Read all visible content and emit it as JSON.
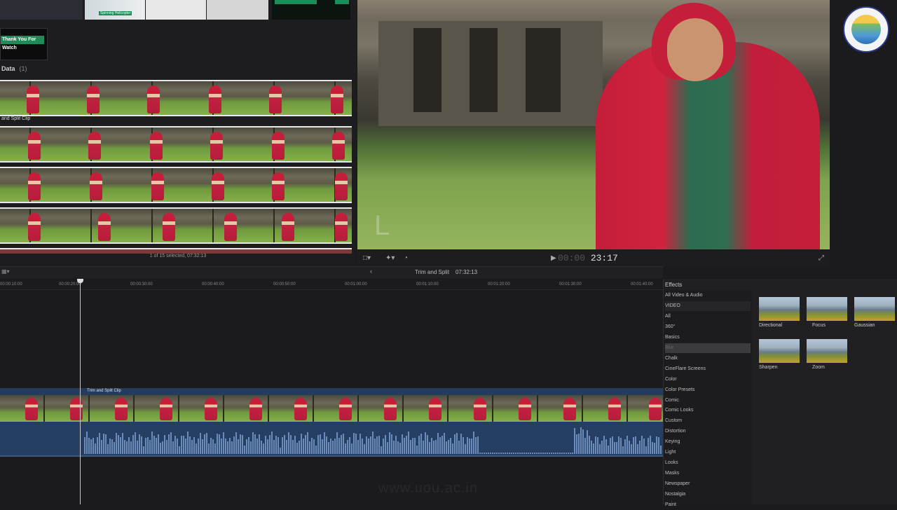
{
  "browser": {
    "thanks_label": "Thank You For Watch",
    "thumb_caption": "Spinning Helicopter",
    "event_name": "Data",
    "event_count": "(1)",
    "clip_name": "and Split Clip",
    "status": "1 of 15 selected, 07:32:13"
  },
  "viewer": {
    "timecode_dim": "00:00",
    "timecode": "23:17",
    "lower_third": "L"
  },
  "timeline": {
    "title": "Trim and Split",
    "duration": "07:32:13",
    "clip_label": "Trim and Split Clip",
    "ruler": [
      "00:00:10:00",
      "00:00:20:00",
      "00:00:30:00",
      "00:00:40:00",
      "00:00:50:00",
      "00:01:00:00",
      "00:01:10:00",
      "00:01:20:00",
      "00:01:30:00",
      "00:01:40:00"
    ],
    "watermark": "www.uou.ac.in"
  },
  "effects": {
    "title": "Effects",
    "categories": [
      "All Video & Audio",
      "VIDEO",
      "All",
      "360°",
      "Basics",
      "Blur",
      "Chalk",
      "CineFlare Screens",
      "Color",
      "Color Presets",
      "Comic",
      "Comic Looks",
      "Custom",
      "Distortion",
      "Keying",
      "Light",
      "Looks",
      "Masks",
      "Newspaper",
      "Nostalgia",
      "Paint"
    ],
    "selected": "Blur",
    "items": [
      "Directional",
      "Focus",
      "Gaussian",
      "Sharpen",
      "Zoom"
    ]
  },
  "colors": {
    "clip_blue": "#233b5c",
    "audio_blue": "#243f63",
    "green_title": "#1e8c58",
    "accent_red": "#c41e3a"
  }
}
